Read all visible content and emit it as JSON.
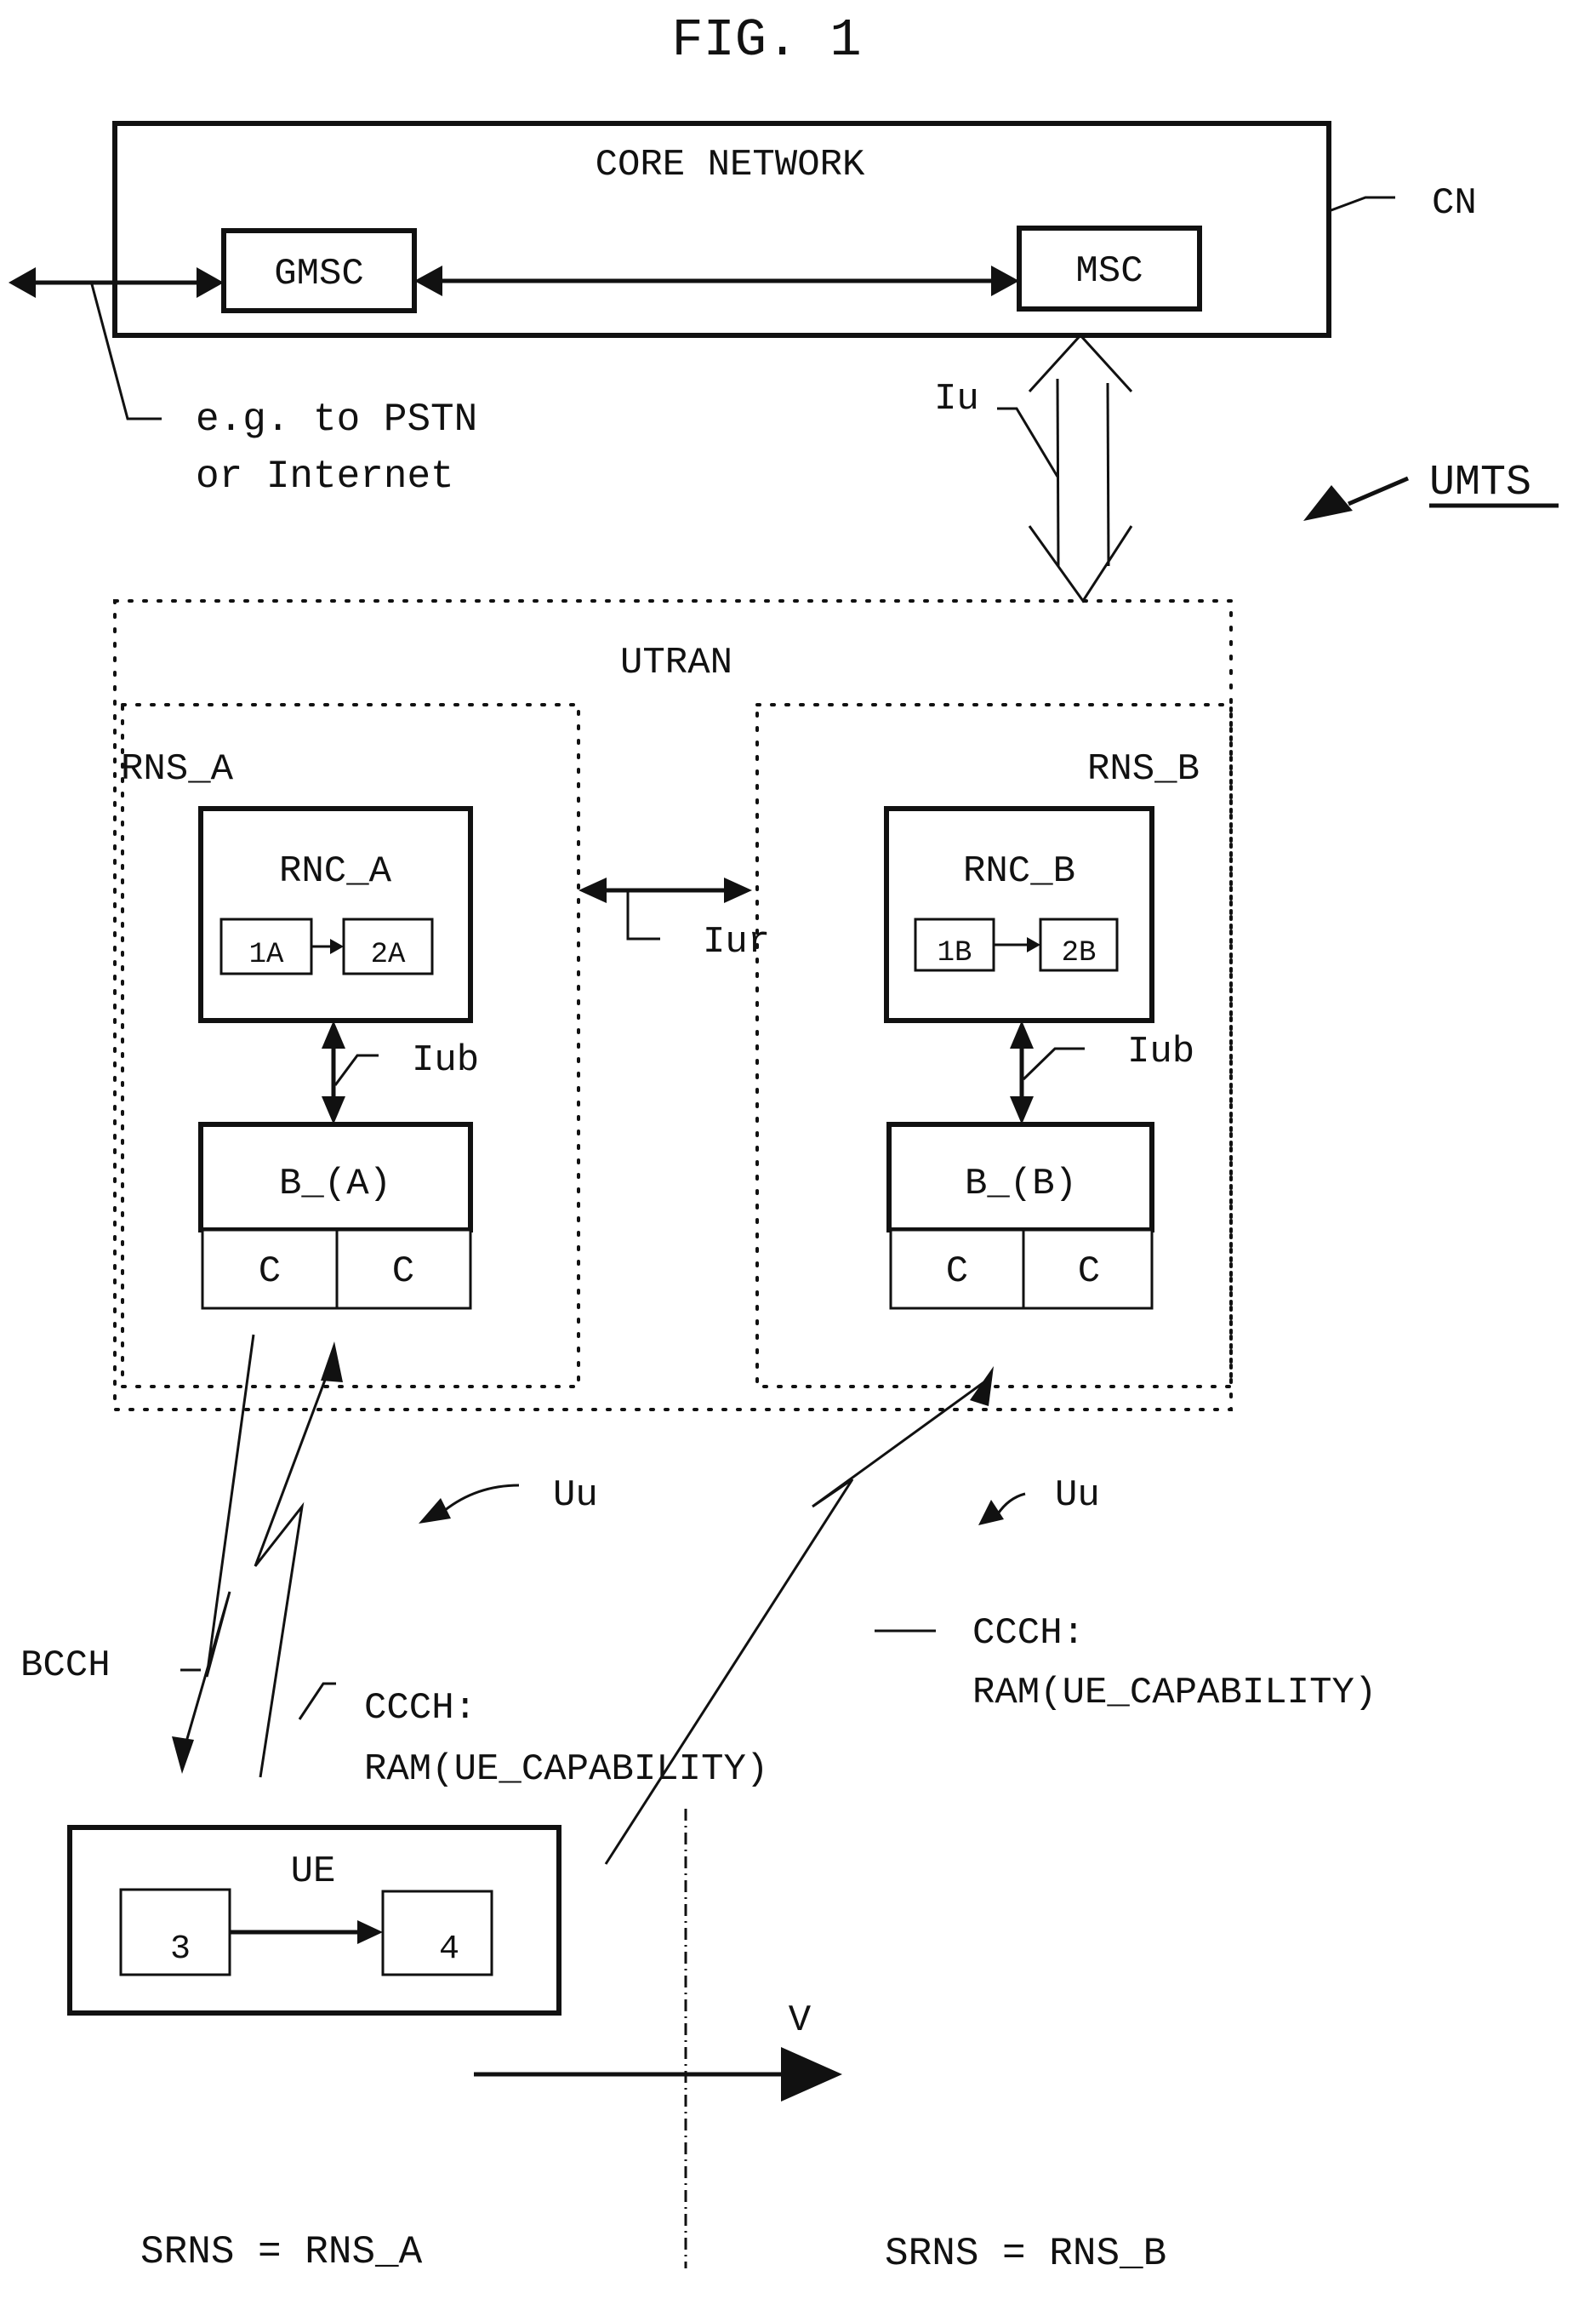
{
  "figure": {
    "title": "FIG. 1",
    "system_label": "UMTS",
    "core_network": {
      "title": "CORE NETWORK",
      "ref": "CN",
      "gmsc": "GMSC",
      "msc": "MSC",
      "external_note_line1": "e.g. to PSTN",
      "external_note_line2": "or Internet",
      "iu": "Iu"
    },
    "utran": {
      "title": "UTRAN",
      "iur": "Iur",
      "rns_a": {
        "label": "RNS_A",
        "rnc": "RNC_A",
        "unit1": "1A",
        "unit2": "2A",
        "iub": "Iub",
        "base": "B_(A)",
        "cells": [
          "C",
          "C"
        ]
      },
      "rns_b": {
        "label": "RNS_B",
        "rnc": "RNC_B",
        "unit1": "1B",
        "unit2": "2B",
        "iub": "Iub",
        "base": "B_(B)",
        "cells": [
          "C",
          "C"
        ]
      }
    },
    "air": {
      "uu_left": "Uu",
      "uu_right": "Uu",
      "bcch": "BCCH",
      "ccch_left_line1": "CCCH:",
      "ccch_left_line2": "RAM(UE_CAPABILITY)",
      "ccch_right_line1": "CCCH:",
      "ccch_right_line2": "RAM(UE_CAPABILITY)"
    },
    "ue": {
      "title": "UE",
      "unit3": "3",
      "unit4": "4"
    },
    "movement": {
      "velocity": "V",
      "srns_left": "SRNS = RNS_A",
      "srns_right": "SRNS = RNS_B"
    }
  }
}
